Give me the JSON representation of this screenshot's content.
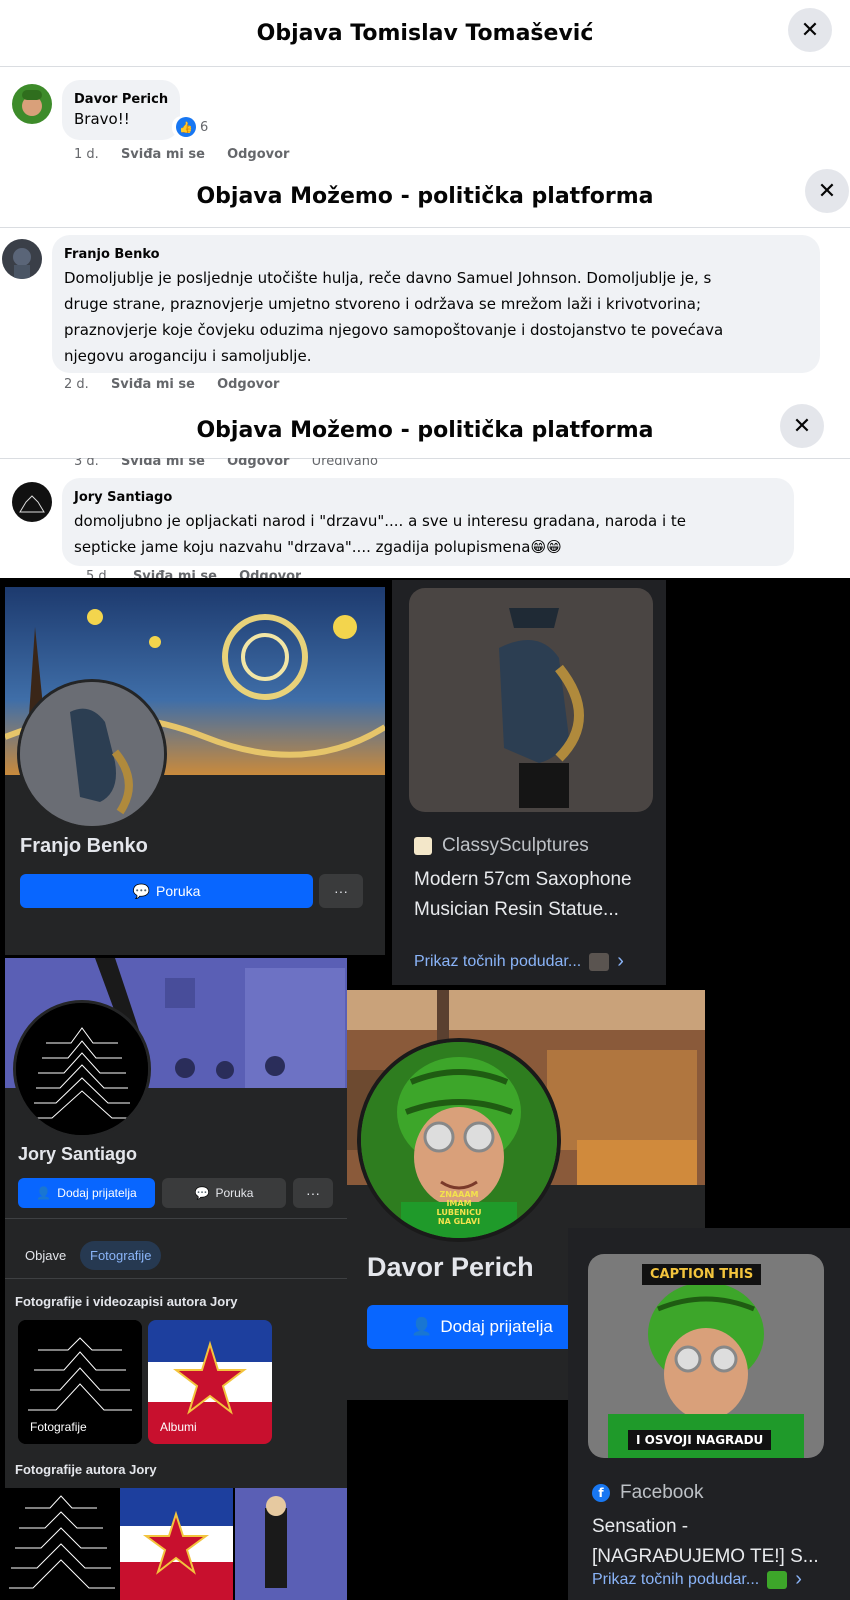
{
  "panel1": {
    "title": "Objava Tomislav Tomašević",
    "close": "✕",
    "comment": {
      "author": "Davor Perich",
      "text": "Bravo!!",
      "reactions": "6",
      "time": "1 d.",
      "like": "Sviđa mi se",
      "reply": "Odgovor"
    }
  },
  "panel2": {
    "title": "Objava Možemo - politička platforma",
    "close": "✕",
    "comment": {
      "author": "Franjo Benko",
      "lines": [
        "Domoljublje je posljednje utočište hulja, reče davno Samuel Johnson. Domoljublje je, s",
        "druge strane, praznovjerje umjetno stvoreno i održava se mrežom laži i krivotvorina;",
        "praznovjerje koje čovjeku oduzima njegovo samopoštovanje i dostojanstvo te povećava",
        "njegovu aroganciju i samoljublje."
      ],
      "time": "2 d.",
      "like": "Sviđa mi se",
      "reply": "Odgovor"
    }
  },
  "panel3": {
    "title": "Objava Možemo - politička platforma",
    "close": "✕",
    "prev_meta": {
      "time": "3 d.",
      "like": "Sviđa mi se",
      "reply": "Odgovor",
      "edited": "Uređivano"
    },
    "comment": {
      "author": "Jory Santiago",
      "lines": [
        "domoljubno je opljackati narod i \"drzavu\".... a sve u interesu gradana, naroda i te",
        "septicke jame koju nazvahu \"drzava\".... zgadija polupismena😁😁"
      ],
      "time": "5 d.",
      "like": "Sviđa mi se",
      "reply": "Odgovor"
    }
  },
  "profile_franjo": {
    "name": "Franjo Benko",
    "message_label": "Poruka",
    "more": "···"
  },
  "lens1": {
    "source": "ClassySculptures",
    "title_lines": [
      "Modern 57cm Saxophone",
      "Musician Resin Statue..."
    ],
    "link": "Prikaz točnih podudar...",
    "chevron": "›"
  },
  "profile_jory": {
    "name": "Jory Santiago",
    "add_friend": "Dodaj prijatelja",
    "message_label": "Poruka",
    "more": "···",
    "tabs": [
      "Objave",
      "Fotografije"
    ],
    "section1": "Fotografije i videozapisi autora Jory",
    "tile_labels": [
      "Fotografije",
      "Albumi"
    ],
    "section2": "Fotografije autora Jory"
  },
  "profile_davor": {
    "name": "Davor Perich",
    "add_friend": "Dodaj prijatelja",
    "avatar_caption": [
      "ZNAAAM",
      "IMAM",
      "LUBENICU",
      "NA GLAVI"
    ]
  },
  "lens2": {
    "banner_top": "CAPTION THIS",
    "banner_bottom": "I OSVOJI NAGRADU",
    "source": "Facebook",
    "title_lines": [
      "Sensation -",
      "[NAGRAĐUJEMO TE!] S..."
    ],
    "link": "Prikaz točnih podudar...",
    "chevron": "›"
  },
  "colors": {
    "fb_blue": "#0866ff",
    "dark_bg": "#242526",
    "lens_bg": "#202124",
    "link": "#8ab4f8"
  }
}
